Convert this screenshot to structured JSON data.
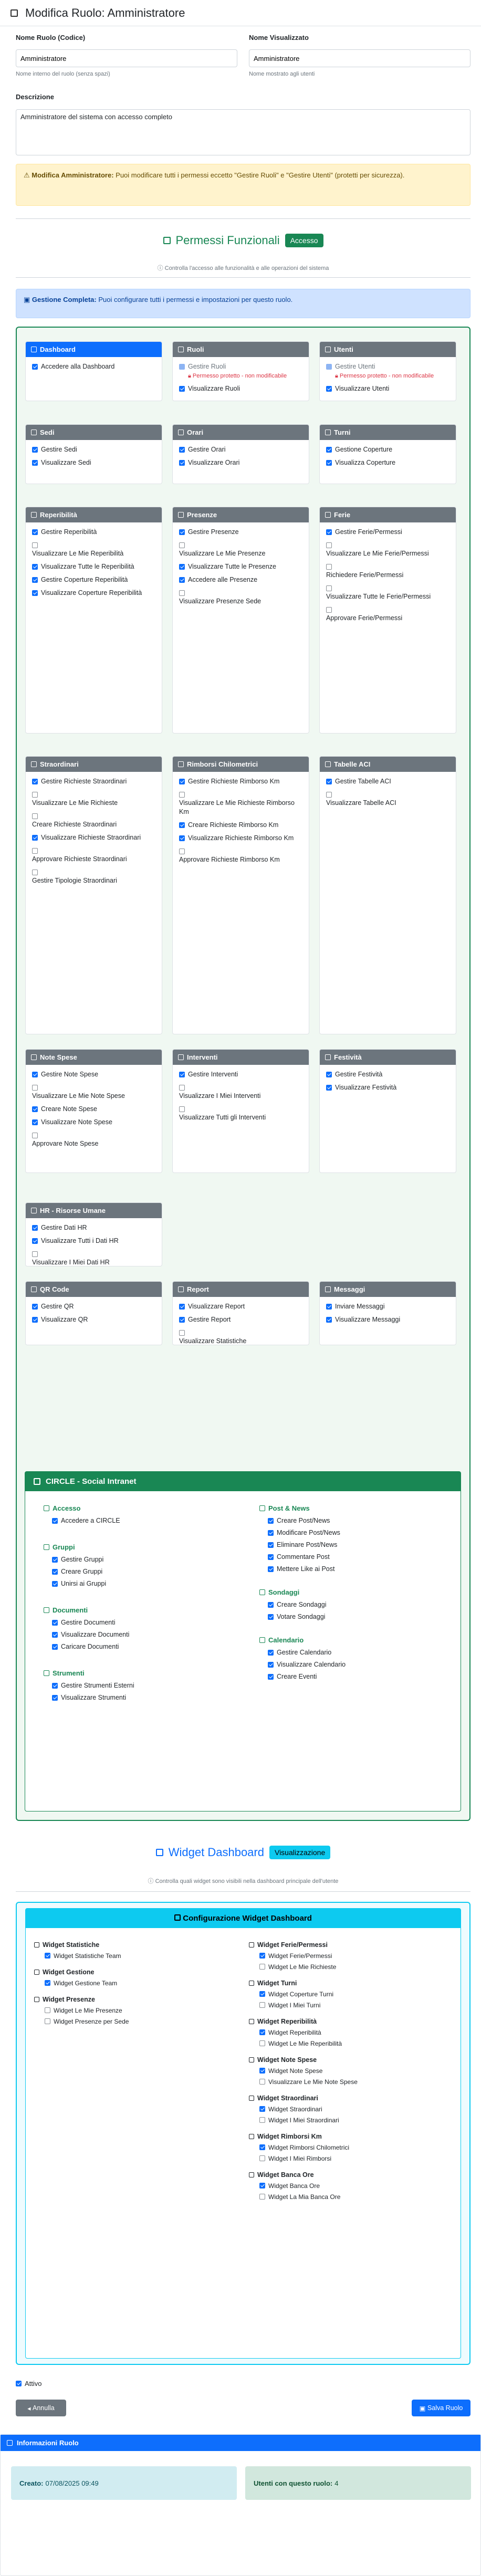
{
  "header": {
    "title": "Modifica Ruolo: Amministratore"
  },
  "form": {
    "name_label": "Nome Ruolo (Codice)",
    "name_value": "Amministratore",
    "name_help": "Nome interno del ruolo (senza spazi)",
    "display_label": "Nome Visualizzato",
    "display_value": "Amministratore",
    "display_help": "Nome mostrato agli utenti",
    "desc_label": "Descrizione",
    "desc_value": "Amministratore del sistema con accesso completo"
  },
  "admin_alert": {
    "strong": "Modifica Amministratore:",
    "text": " Puoi modificare tutti i permessi eccetto \"Gestire Ruoli\" e \"Gestire Utenti\" (protetti per sicurezza)."
  },
  "functional": {
    "title": "Permessi Funzionali",
    "badge": "Accesso",
    "subtitle": "Controlla l'accesso alle funzionalità e alle operazioni del sistema",
    "info_strong": "Gestione Completa:",
    "info_text": " Puoi configurare tutti i permessi e impostazioni per questo ruolo."
  },
  "protected_note": "Permesso protetto - non modificabile",
  "cards": [
    {
      "title": "Dashboard",
      "active": true,
      "perms": [
        {
          "label": "Accedere alla Dashboard",
          "on": true
        }
      ]
    },
    {
      "title": "Ruoli",
      "perms": [
        {
          "label": "Gestire Ruoli",
          "on": true,
          "protected": true
        },
        {
          "label": "Visualizzare Ruoli",
          "on": true
        }
      ]
    },
    {
      "title": "Utenti",
      "perms": [
        {
          "label": "Gestire Utenti",
          "on": true,
          "protected": true
        },
        {
          "label": "Visualizzare Utenti",
          "on": true
        }
      ]
    },
    {
      "title": "Sedi",
      "perms": [
        {
          "label": "Gestire Sedi",
          "on": true
        },
        {
          "label": "Visualizzare Sedi",
          "on": true
        }
      ]
    },
    {
      "title": "Orari",
      "perms": [
        {
          "label": "Gestire Orari",
          "on": true
        },
        {
          "label": "Visualizzare Orari",
          "on": true
        }
      ]
    },
    {
      "title": "Turni",
      "perms": [
        {
          "label": "Gestione Coperture",
          "on": true
        },
        {
          "label": "Visualizza Coperture",
          "on": true
        }
      ]
    },
    {
      "title": "Reperibilità",
      "perms": [
        {
          "label": "Gestire Reperibilità",
          "on": true
        },
        {
          "label": "Visualizzare Le Mie Reperibilità",
          "on": false
        },
        {
          "label": "Visualizzare Tutte le Reperibilità",
          "on": true
        },
        {
          "label": "Gestire Coperture Reperibilità",
          "on": true
        },
        {
          "label": "Visualizzare Coperture Reperibilità",
          "on": true
        }
      ]
    },
    {
      "title": "Presenze",
      "perms": [
        {
          "label": "Gestire Presenze",
          "on": true
        },
        {
          "label": "Visualizzare Le Mie Presenze",
          "on": false
        },
        {
          "label": "Visualizzare Tutte le Presenze",
          "on": true
        },
        {
          "label": "Accedere alle Presenze",
          "on": true
        },
        {
          "label": "Visualizzare Presenze Sede",
          "on": false
        }
      ]
    },
    {
      "title": "Ferie",
      "perms": [
        {
          "label": "Gestire Ferie/Permessi",
          "on": true
        },
        {
          "label": "Visualizzare Le Mie Ferie/Permessi",
          "on": false
        },
        {
          "label": "Richiedere Ferie/Permessi",
          "on": false
        },
        {
          "label": "Visualizzare Tutte le Ferie/Permessi",
          "on": false
        },
        {
          "label": "Approvare Ferie/Permessi",
          "on": false
        }
      ]
    },
    {
      "title": "Straordinari",
      "perms": [
        {
          "label": "Gestire Richieste Straordinari",
          "on": true
        },
        {
          "label": "Visualizzare Le Mie Richieste",
          "on": false
        },
        {
          "label": "Creare Richieste Straordinari",
          "on": false
        },
        {
          "label": "Visualizzare Richieste Straordinari",
          "on": true
        },
        {
          "label": "Approvare Richieste Straordinari",
          "on": false
        },
        {
          "label": "Gestire Tipologie Straordinari",
          "on": false
        }
      ]
    },
    {
      "title": "Rimborsi Chilometrici",
      "perms": [
        {
          "label": "Gestire Richieste Rimborso Km",
          "on": true
        },
        {
          "label": "Visualizzare Le Mie Richieste Rimborso Km",
          "on": false
        },
        {
          "label": "Creare Richieste Rimborso Km",
          "on": true
        },
        {
          "label": "Visualizzare Richieste Rimborso Km",
          "on": true
        },
        {
          "label": "Approvare Richieste Rimborso Km",
          "on": false
        }
      ]
    },
    {
      "title": "Tabelle ACI",
      "perms": [
        {
          "label": "Gestire Tabelle ACI",
          "on": true
        },
        {
          "label": "Visualizzare Tabelle ACI",
          "on": false
        }
      ]
    },
    {
      "title": "Note Spese",
      "perms": [
        {
          "label": "Gestire Note Spese",
          "on": true
        },
        {
          "label": "Visualizzare Le Mie Note Spese",
          "on": false
        },
        {
          "label": "Creare Note Spese",
          "on": true
        },
        {
          "label": "Visualizzare Note Spese",
          "on": true
        },
        {
          "label": "Approvare Note Spese",
          "on": false
        }
      ]
    },
    {
      "title": "Interventi",
      "perms": [
        {
          "label": "Gestire Interventi",
          "on": true
        },
        {
          "label": "Visualizzare I Miei Interventi",
          "on": false
        },
        {
          "label": "Visualizzare Tutti gli Interventi",
          "on": false
        }
      ]
    },
    {
      "title": "Festività",
      "perms": [
        {
          "label": "Gestire Festività",
          "on": true
        },
        {
          "label": "Visualizzare Festività",
          "on": true
        }
      ]
    },
    {
      "title": "HR - Risorse Umane",
      "perms": [
        {
          "label": "Gestire Dati HR",
          "on": true
        },
        {
          "label": "Visualizzare Tutti i Dati HR",
          "on": true
        },
        {
          "label": "Visualizzare I Miei Dati HR",
          "on": false
        }
      ]
    },
    {
      "title": "QR Code",
      "perms": [
        {
          "label": "Gestire QR",
          "on": true
        },
        {
          "label": "Visualizzare QR",
          "on": true
        }
      ]
    },
    {
      "title": "Report",
      "perms": [
        {
          "label": "Visualizzare Report",
          "on": true
        },
        {
          "label": "Gestire Report",
          "on": true
        },
        {
          "label": "Visualizzare Statistiche",
          "on": false
        }
      ]
    },
    {
      "title": "Messaggi",
      "perms": [
        {
          "label": "Inviare Messaggi",
          "on": true
        },
        {
          "label": "Visualizzare Messaggi",
          "on": true
        }
      ]
    }
  ],
  "circle": {
    "title": "CIRCLE - Social Intranet",
    "left": [
      {
        "title": "Accesso",
        "items": [
          {
            "label": "Accedere a CIRCLE",
            "on": true
          }
        ]
      },
      {
        "title": "Gruppi",
        "items": [
          {
            "label": "Gestire Gruppi",
            "on": true
          },
          {
            "label": "Creare Gruppi",
            "on": true
          },
          {
            "label": "Unirsi ai Gruppi",
            "on": true
          }
        ]
      },
      {
        "title": "Documenti",
        "items": [
          {
            "label": "Gestire Documenti",
            "on": true
          },
          {
            "label": "Visualizzare Documenti",
            "on": true
          },
          {
            "label": "Caricare Documenti",
            "on": true
          }
        ]
      },
      {
        "title": "Strumenti",
        "items": [
          {
            "label": "Gestire Strumenti Esterni",
            "on": true
          },
          {
            "label": "Visualizzare Strumenti",
            "on": true
          }
        ]
      }
    ],
    "right": [
      {
        "title": "Post & News",
        "items": [
          {
            "label": "Creare Post/News",
            "on": true
          },
          {
            "label": "Modificare Post/News",
            "on": true
          },
          {
            "label": "Eliminare Post/News",
            "on": true
          },
          {
            "label": "Commentare Post",
            "on": true
          },
          {
            "label": "Mettere Like ai Post",
            "on": true
          }
        ]
      },
      {
        "title": "Sondaggi",
        "items": [
          {
            "label": "Creare Sondaggi",
            "on": true
          },
          {
            "label": "Votare Sondaggi",
            "on": true
          }
        ]
      },
      {
        "title": "Calendario",
        "items": [
          {
            "label": "Gestire Calendario",
            "on": true
          },
          {
            "label": "Visualizzare Calendario",
            "on": true
          },
          {
            "label": "Creare Eventi",
            "on": true
          }
        ]
      }
    ]
  },
  "widgets": {
    "title": "Widget Dashboard",
    "badge": "Visualizzazione",
    "subtitle": "Controlla quali widget sono visibili nella dashboard principale dell'utente",
    "config_title": "Configurazione Widget Dashboard",
    "left": [
      {
        "group": "Widget Statistiche",
        "items": [
          {
            "label": "Widget Statistiche Team",
            "on": true
          }
        ]
      },
      {
        "group": "Widget Gestione",
        "items": [
          {
            "label": "Widget Gestione Team",
            "on": true
          }
        ]
      },
      {
        "group": "Widget Presenze",
        "items": [
          {
            "label": "Widget Le Mie Presenze",
            "on": false
          },
          {
            "label": "Widget Presenze per Sede",
            "on": false
          }
        ]
      }
    ],
    "right": [
      {
        "group": "Widget Ferie/Permessi",
        "items": [
          {
            "label": "Widget Ferie/Permessi",
            "on": true
          },
          {
            "label": "Widget Le Mie Richieste",
            "on": false
          }
        ]
      },
      {
        "group": "Widget Turni",
        "items": [
          {
            "label": "Widget Coperture Turni",
            "on": true
          },
          {
            "label": "Widget I Miei Turni",
            "on": false
          }
        ]
      },
      {
        "group": "Widget Reperibilità",
        "items": [
          {
            "label": "Widget Reperibilità",
            "on": true
          },
          {
            "label": "Widget Le Mie Reperibilità",
            "on": false
          }
        ]
      },
      {
        "group": "Widget Note Spese",
        "items": [
          {
            "label": "Widget Note Spese",
            "on": true
          },
          {
            "label": "Visualizzare Le Mie Note Spese",
            "on": false
          }
        ]
      },
      {
        "group": "Widget Straordinari",
        "items": [
          {
            "label": "Widget Straordinari",
            "on": true
          },
          {
            "label": "Widget I Miei Straordinari",
            "on": false
          }
        ]
      },
      {
        "group": "Widget Rimborsi Km",
        "items": [
          {
            "label": "Widget Rimborsi Chilometrici",
            "on": true
          },
          {
            "label": "Widget I Miei Rimborsi",
            "on": false
          }
        ]
      },
      {
        "group": "Widget Banca Ore",
        "items": [
          {
            "label": "Widget Banca Ore",
            "on": true
          },
          {
            "label": "Widget La Mia Banca Ore",
            "on": false
          }
        ]
      }
    ]
  },
  "footer": {
    "active_label": "Attivo",
    "cancel": "Annulla",
    "save": "Salva Ruolo"
  },
  "info": {
    "title": "Informazioni Ruolo",
    "created_label": "Creato:",
    "created_value": "07/08/2025 09:49",
    "users_label": "Utenti con questo ruolo:",
    "users_value": "4"
  },
  "colors": {
    "primary": "#0d6efd",
    "success": "#198754",
    "info": "#0dcaf0",
    "secondary": "#6c757d",
    "warning_bg": "#fff3cd"
  }
}
